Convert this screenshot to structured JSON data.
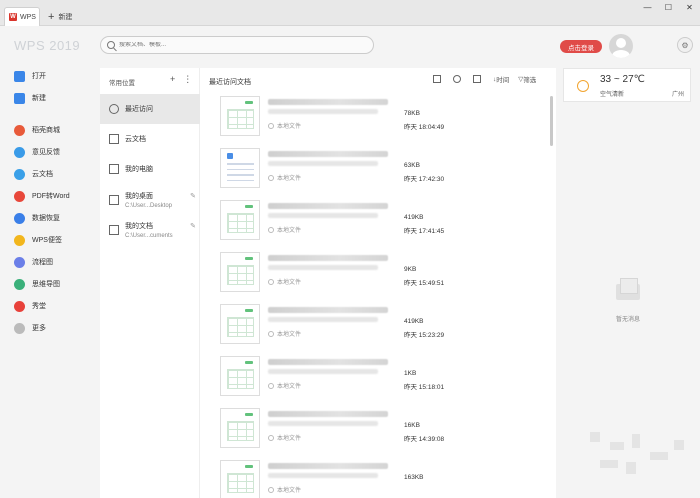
{
  "tabs": {
    "home": "WPS",
    "new": "新建"
  },
  "brand": "WPS 2019",
  "search": {
    "placeholder": "搜索文档、模板..."
  },
  "login_label": "点击登录",
  "sidebar": {
    "items": [
      {
        "label": "打开",
        "icon": "folder-icon",
        "color": "#3a86e8"
      },
      {
        "label": "新建",
        "icon": "plus-icon",
        "color": "#3a86e8"
      },
      {
        "label": "稻壳商城",
        "icon": "store-icon",
        "color": "#e85a3a"
      },
      {
        "label": "意见反馈",
        "icon": "feedback-icon",
        "color": "#3a9be8"
      },
      {
        "label": "云文档",
        "icon": "cloud-icon",
        "color": "#3aa0e8"
      },
      {
        "label": "PDF转Word",
        "icon": "pdf-icon",
        "color": "#e8473a"
      },
      {
        "label": "数据恢复",
        "icon": "recover-icon",
        "color": "#3a7fe8"
      },
      {
        "label": "WPS便签",
        "icon": "note-icon",
        "color": "#f2b61d"
      },
      {
        "label": "流程图",
        "icon": "flowchart-icon",
        "color": "#6b7fe8"
      },
      {
        "label": "思维导图",
        "icon": "mindmap-icon",
        "color": "#3ab07a"
      },
      {
        "label": "秀堂",
        "icon": "show-icon",
        "color": "#e8413a"
      },
      {
        "label": "更多",
        "icon": "more-icon",
        "color": "#bbbbbb"
      }
    ]
  },
  "locations": {
    "header": "常用位置",
    "items": [
      {
        "label": "最近访问",
        "sub": "",
        "icon": "clock-icon"
      },
      {
        "label": "云文档",
        "sub": "",
        "icon": "cloud-doc-icon"
      },
      {
        "label": "我的电脑",
        "sub": "",
        "icon": "computer-icon"
      },
      {
        "label": "我的桌面",
        "sub": "C:\\User...Desktop",
        "icon": "desktop-icon"
      },
      {
        "label": "我的文档",
        "sub": "C:\\User...cuments",
        "icon": "documents-icon"
      }
    ]
  },
  "filelist": {
    "title": "最近访问文档",
    "sort_label": "时间",
    "filter_label": "筛选",
    "location_text": "本地文件",
    "files": [
      {
        "type": "sheet",
        "size": "78KB",
        "time": "昨天 18:04:49"
      },
      {
        "type": "doc",
        "size": "63KB",
        "time": "昨天 17:42:30"
      },
      {
        "type": "sheet",
        "size": "419KB",
        "time": "昨天 17:41:45"
      },
      {
        "type": "sheet",
        "size": "9KB",
        "time": "昨天 15:49:51"
      },
      {
        "type": "sheet",
        "size": "419KB",
        "time": "昨天 15:23:29"
      },
      {
        "type": "sheet",
        "size": "1KB",
        "time": "昨天 15:18:01"
      },
      {
        "type": "sheet",
        "size": "16KB",
        "time": "昨天 14:39:08"
      },
      {
        "type": "sheet",
        "size": "163KB",
        "time": ""
      }
    ]
  },
  "weather": {
    "temp": "33 ~ 27℃",
    "air": "空气清新",
    "city": "广州"
  },
  "empty_message": "暂无消息"
}
